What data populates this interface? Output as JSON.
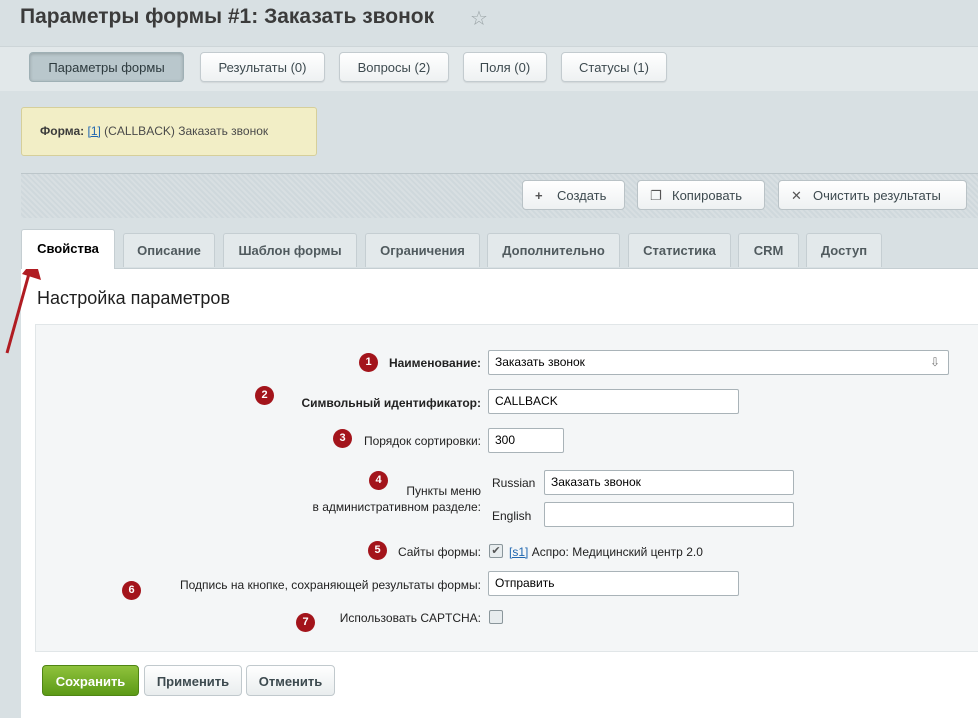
{
  "page": {
    "title": "Параметры формы #1: Заказать звонок"
  },
  "top_tabs": [
    "Параметры формы",
    "Результаты (0)",
    "Вопросы (2)",
    "Поля (0)",
    "Статусы (1)"
  ],
  "info": {
    "label": "Форма:",
    "link": "[1]",
    "text": "(CALLBACK) Заказать звонок"
  },
  "toolbar": {
    "create": "Создать",
    "copy": "Копировать",
    "clear": "Очистить результаты"
  },
  "tabs": [
    "Свойства",
    "Описание",
    "Шаблон формы",
    "Ограничения",
    "Дополнительно",
    "Статистика",
    "CRM",
    "Доступ"
  ],
  "panel_title": "Настройка параметров",
  "form": {
    "name_label": "Наименование:",
    "name_value": "Заказать звонок",
    "sid_label": "Символьный идентификатор:",
    "sid_value": "CALLBACK",
    "sort_label": "Порядок сортировки:",
    "sort_value": "300",
    "menu_label_1": "Пункты меню",
    "menu_label_2": "в административном разделе:",
    "lang_ru": "Russian",
    "menu_ru": "Заказать звонок",
    "lang_en": "English",
    "menu_en": "",
    "sites_label": "Сайты формы:",
    "site_link": "[s1]",
    "site_text": "Аспро: Медицинский центр 2.0",
    "button_label": "Подпись на кнопке, сохраняющей результаты формы:",
    "button_value": "Отправить",
    "captcha_label": "Использовать CAPTCHA:"
  },
  "badges": [
    "1",
    "2",
    "3",
    "4",
    "5",
    "6",
    "7"
  ],
  "buttons": {
    "save": "Сохранить",
    "apply": "Применить",
    "cancel": "Отменить"
  },
  "colors": {
    "badge": "#a3141b",
    "save": "#6aa61e",
    "annotation_arrow": "#b01c22"
  }
}
